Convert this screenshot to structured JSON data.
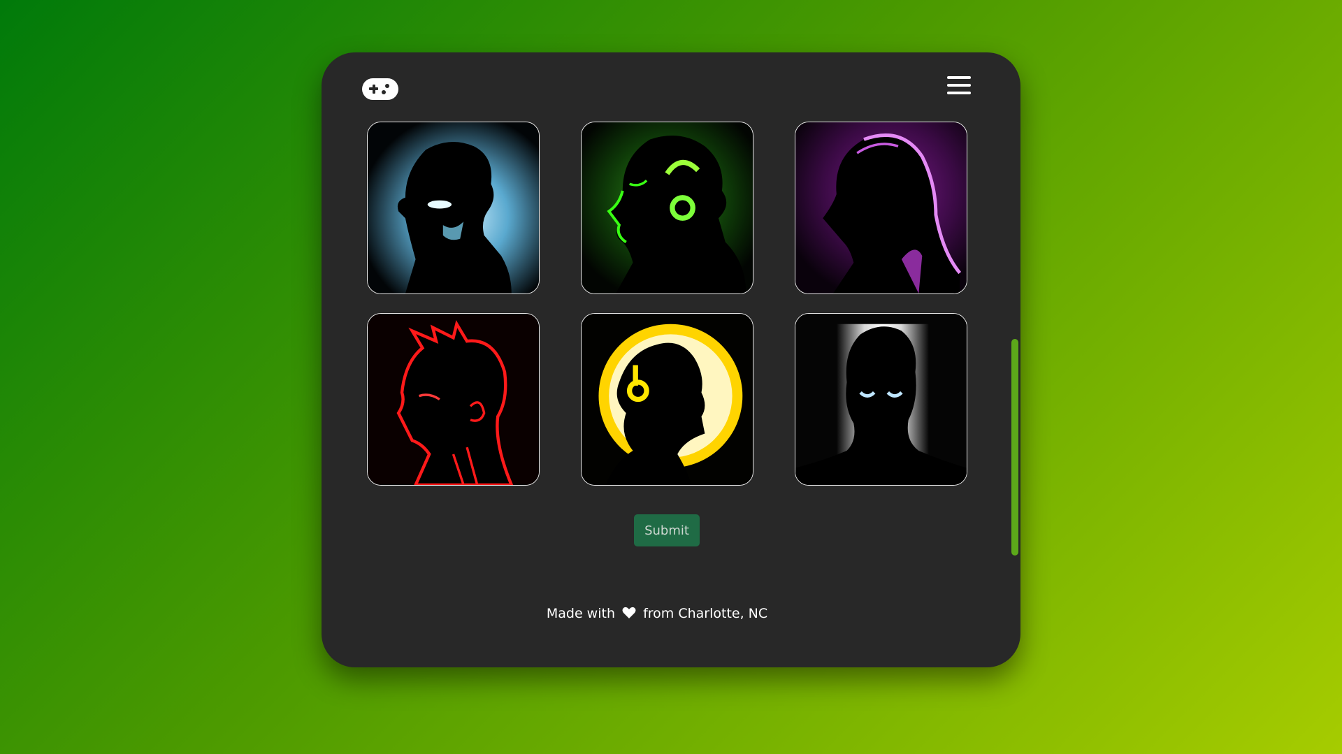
{
  "header": {
    "logo_icon": "gamepad-icon",
    "menu_icon": "hamburger-menu-icon"
  },
  "avatars": [
    {
      "icon": "avatar-blue-icon",
      "color": "#7ec8e8"
    },
    {
      "icon": "avatar-green-icon",
      "color": "#39ff14"
    },
    {
      "icon": "avatar-purple-icon",
      "color": "#d95cf0"
    },
    {
      "icon": "avatar-red-icon",
      "color": "#ff1a1a"
    },
    {
      "icon": "avatar-yellow-icon",
      "color": "#ffd400"
    },
    {
      "icon": "avatar-white-icon",
      "color": "#ffffff"
    }
  ],
  "form": {
    "submit_label": "Submit"
  },
  "footer": {
    "text_before": "Made with",
    "heart_icon": "heart-icon",
    "text_after": "from Charlotte, NC"
  },
  "colors": {
    "panel": "#282828",
    "accent_button": "#1f6b45",
    "scrollbar": "#5ca81a",
    "bg_start": "#007a0a",
    "bg_end": "#a6cc00"
  }
}
